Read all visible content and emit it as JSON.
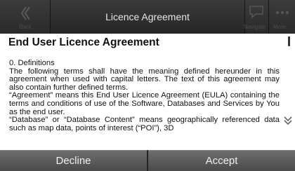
{
  "header": {
    "title": "Licence Agreement",
    "back_label": "Back",
    "nav_label": "Navigate",
    "more_label": "More"
  },
  "document": {
    "heading": "End User Licence Agreement",
    "paragraphs": [
      "0. Definitions",
      "The following terms shall have the meaning defined hereunder in this agreement when used with capital letters. The text of this agreement may also contain further defined terms.",
      "“Agreement” means this End User Licence Agreement (EULA) containing the terms and conditions of use of the Software, Databases and Services by You as the end user.",
      "“Database” or “Database Content” means geographically referenced data such as map data, points of interest (“POI”), 3D"
    ]
  },
  "footer": {
    "decline_label": "Decline",
    "accept_label": "Accept"
  },
  "icons": {
    "back": "chevron-left-icon",
    "nav": "speech-bubble-icon",
    "more": "dots-icon",
    "scroll_down": "chevron-down-icon"
  },
  "colors": {
    "topbar": "#2e2e2e",
    "document_bg": "#ffffff",
    "button": "#5c5c5c",
    "text_light": "#e6e6e6"
  }
}
